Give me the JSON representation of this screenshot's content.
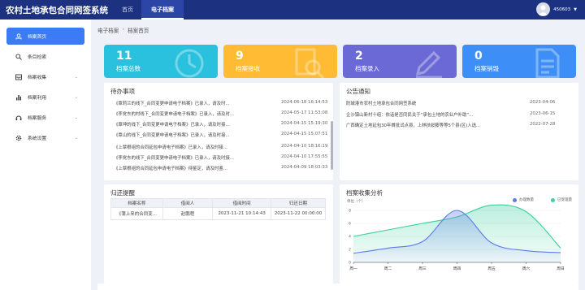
{
  "header": {
    "title": "农村土地承包合同网签系统",
    "nav": [
      "首页",
      "电子档案"
    ],
    "active_nav": 1,
    "username": "450603"
  },
  "sidebar": {
    "items": [
      {
        "label": "档案首页",
        "icon": "home-icon",
        "active": true,
        "expand": false
      },
      {
        "label": "条目检索",
        "icon": "search-icon",
        "active": false,
        "expand": false
      },
      {
        "label": "档案收集",
        "icon": "inbox-icon",
        "active": false,
        "expand": true
      },
      {
        "label": "档案利用",
        "icon": "bar-chart-icon",
        "active": false,
        "expand": true
      },
      {
        "label": "档案服务",
        "icon": "service-icon",
        "active": false,
        "expand": true
      },
      {
        "label": "系统设置",
        "icon": "gear-icon",
        "active": false,
        "expand": true
      }
    ]
  },
  "breadcrumb": [
    "电子档案",
    "档案首页"
  ],
  "stat_cards": [
    {
      "value": "11",
      "label": "档案总数",
      "color": "#29c1dd",
      "icon": "clock-icon"
    },
    {
      "value": "9",
      "label": "档案接收",
      "color": "#ffbb33",
      "icon": "search-doc-icon"
    },
    {
      "value": "2",
      "label": "档案录入",
      "color": "#6a69d6",
      "icon": "pencil-icon"
    },
    {
      "value": "0",
      "label": "档案销毁",
      "color": "#3e8ef7",
      "icon": "document-icon"
    }
  ],
  "todo": {
    "title": "待办事项",
    "items": [
      {
        "text": "《覃莉兰的线下_合同变更申请电子档案》已录入，请及时...",
        "date": "2024-06-18 16:14:53"
      },
      {
        "text": "《李党东的村线下_合同变更申请电子档案》已录入，请及时...",
        "date": "2024-05-17 11:53:08"
      },
      {
        "text": "《覃坤的线下_合同变更申请电子档案》已录入，请及时接...",
        "date": "2024-04-15 15:19:30"
      },
      {
        "text": "《覃山的线下_合同变更申请电子档案》已录入，请及时接...",
        "date": "2024-04-15 15:07:51"
      },
      {
        "text": "《上覃根组的合同延包申请电子档案》已录入，请及时接...",
        "date": "2024-04-10 18:16:19"
      },
      {
        "text": "《李党东的线下_合同变更申请电子档案》已录入，请及时接...",
        "date": "2024-04-10 17:55:55"
      },
      {
        "text": "《上覃根组的合同延包申请电子档案》待鉴定，请及时鉴...",
        "date": "2024-04-09 18:03:33"
      }
    ]
  },
  "notice": {
    "title": "公告通知",
    "items": [
      {
        "text": "防城港市农村土地承包合同网签系统",
        "date": "2023-04-06"
      },
      {
        "text": "企沙镇山新村十组：依话是否同民关于“承包土地的农业户补助”...",
        "date": "2023-06-15"
      },
      {
        "text": "广西确定土地延包30年首批试点县，上林扶绥藤等等5个县(区)入选...",
        "date": "2022-07-28"
      }
    ]
  },
  "return_reminder": {
    "title": "归还提醒",
    "columns": [
      "档案名称",
      "借阅人",
      "借阅时间",
      "归还日期"
    ],
    "rows": [
      [
        "《蒲上来的合同变...",
        "赵鹏程",
        "2023-11-21 10:14:43",
        "2023-11-22 00:00:00"
      ]
    ]
  },
  "chart_title": "档案收集分析",
  "chart_data": {
    "type": "area",
    "ylabel": "单位（个）",
    "ylim": [
      0,
      8
    ],
    "yticks": [
      "0",
      "2",
      "4",
      "6",
      "8"
    ],
    "categories": [
      "周一",
      "周二",
      "周三",
      "周四",
      "周五",
      "周六",
      "周日"
    ],
    "series": [
      {
        "name": "办理数量",
        "color": "#5a7be6",
        "values": [
          1.4,
          2.2,
          3.2,
          8.0,
          3.0,
          1.8,
          1.5
        ]
      },
      {
        "name": "已受理量",
        "color": "#3ccf9f",
        "values": [
          4.0,
          5.0,
          6.0,
          7.0,
          8.8,
          7.8,
          2.2
        ]
      }
    ]
  }
}
